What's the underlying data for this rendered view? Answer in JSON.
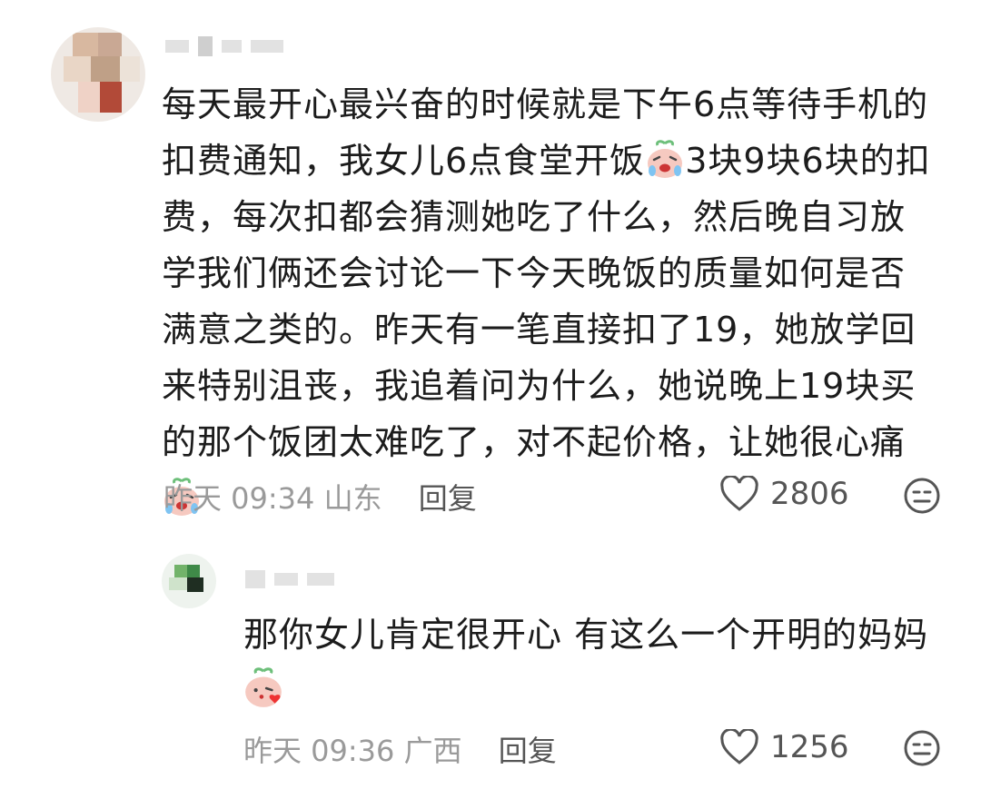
{
  "comments": [
    {
      "text_part1": "每天最开心最兴奋的时候就是下午6点等待手机的扣费通知，我女儿6点食堂开饭",
      "text_part2": "3块9块6块的扣费，每次扣都会猜测她吃了什么，然后晚自习放学我们俩还会讨论一下今天晚饭的质量如何是否满意之类的。昨天有一笔直接扣了19，她放学回来特别沮丧，我追着问为什么，她说晚上19块买的那个饭团太难吃了，对不起价格，让她很心痛",
      "time": "昨天 09:34",
      "location": "山东",
      "reply_label": "回复",
      "likes": "2806",
      "emoji_inline": "crying-laughing-emoji"
    },
    {
      "text": "那你女儿肯定很开心 有这么一个开明的妈妈",
      "time": "昨天 09:36",
      "location": "广西",
      "reply_label": "回复",
      "likes": "1256",
      "emoji_inline": "blushing-emoji"
    }
  ],
  "colors": {
    "meta": "#9a9a9a",
    "text": "#1c1c1c",
    "icon": "#555555"
  }
}
